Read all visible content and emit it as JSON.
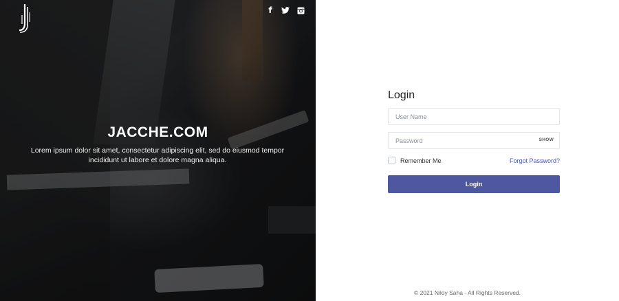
{
  "hero": {
    "title": "JACCHE.COM",
    "subtitle": "Lorem ipsum dolor sit amet, consectetur adipiscing elit, sed do eiusmod tempor incididunt ut labore et dolore magna aliqua.",
    "social": [
      {
        "icon": "facebook-icon",
        "glyph": "f"
      },
      {
        "icon": "twitter-icon",
        "glyph": "🐦"
      },
      {
        "icon": "instagram-icon",
        "glyph": "◙"
      }
    ]
  },
  "login": {
    "title": "Login",
    "username_placeholder": "User Name",
    "password_placeholder": "Password",
    "show_label": "SHOW",
    "remember_label": "Remember Me",
    "forgot_label": "Forgot Password?",
    "button_label": "Login"
  },
  "footer": {
    "copyright": "© 2021 Niloy Saha - All Rights Reserved."
  },
  "colors": {
    "accent": "#4d58a0",
    "link": "#4a56a6"
  }
}
